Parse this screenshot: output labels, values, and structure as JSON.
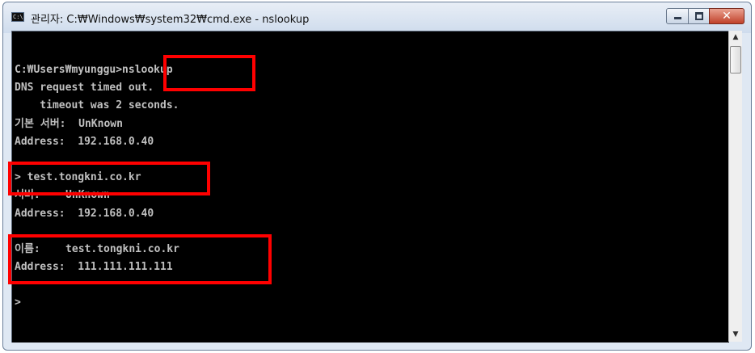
{
  "window": {
    "title": "관리자: C:₩Windows₩system32₩cmd.exe - nslookup",
    "icon_label": "C:\\"
  },
  "console": {
    "lines": [
      "C:₩Users₩myunggu>nslookup",
      "DNS request timed out.",
      "    timeout was 2 seconds.",
      "기본 서버:  UnKnown",
      "Address:  192.168.0.40",
      "",
      "> test.tongkni.co.kr",
      "서버:    UnKnown",
      "Address:  192.168.0.40",
      "",
      "이름:    test.tongkni.co.kr",
      "Address:  111.111.111.111",
      "",
      ">"
    ]
  },
  "colors": {
    "highlight": "#ff0000",
    "console_bg": "#000000",
    "console_text": "#c0c0c0"
  },
  "icons": {
    "minimize": "minimize-icon",
    "maximize": "maximize-icon",
    "close": "close-icon",
    "scroll_up": "scroll-up-arrow-icon",
    "scroll_down": "scroll-down-arrow-icon"
  }
}
